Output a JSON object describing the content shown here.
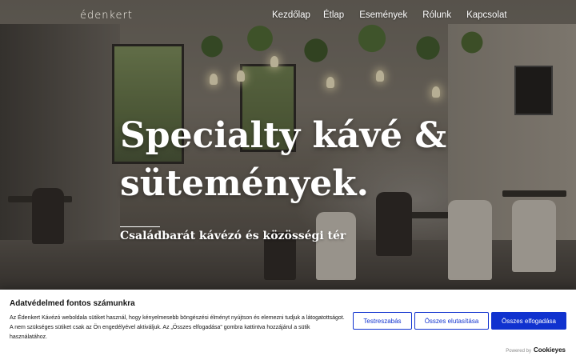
{
  "brand": {
    "logo_text": "édenkert"
  },
  "nav": {
    "items": [
      {
        "label": "Kezdőlap"
      },
      {
        "label": "Étlap"
      },
      {
        "label": "Események"
      },
      {
        "label": "Rólunk"
      },
      {
        "label": "Kapcsolat"
      }
    ]
  },
  "hero": {
    "headline_line1": "Specialty kávé &",
    "headline_line2": "sütemények.",
    "subheadline": "Családbarát kávézó és közösségi tér"
  },
  "cookie_banner": {
    "title": "Adatvédelmed fontos számunkra",
    "body": "Az Édenkert Kávézó weboldala sütiket használ, hogy kényelmesebb böngészési élményt nyújtson és elemezni tudjuk a látogatottságot. A nem szükséges sütiket csak az Ön engedélyével aktiváljuk. Az „Összes elfogadása” gombra kattintva hozzájárul a sütik használatához.",
    "buttons": {
      "customize": "Testreszabás",
      "decline_all": "Összes elutasítása",
      "accept_all": "Összes elfogadása"
    },
    "powered_by": "Powered by",
    "powered_logo": "Cookieyes",
    "accent_color": "#1032CF"
  }
}
